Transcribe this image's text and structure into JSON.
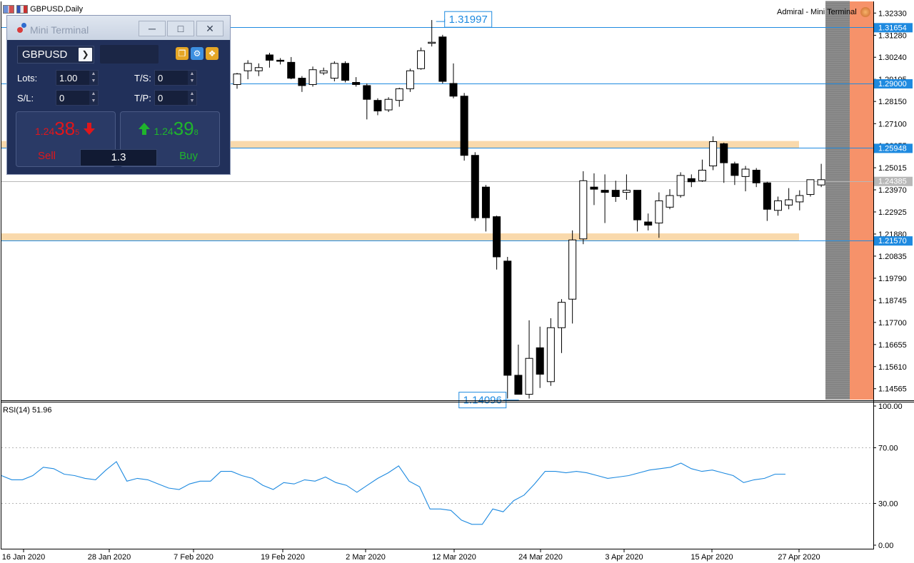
{
  "window": {
    "title": "GBPUSD,Daily",
    "broker_label": "Admiral - Mini Terminal"
  },
  "mini_terminal": {
    "title": "Mini Terminal",
    "symbol": "GBPUSD",
    "lots_label": "Lots:",
    "lots_value": "1.00",
    "ts_label": "T/S:",
    "ts_value": "0",
    "sl_label": "S/L:",
    "sl_value": "0",
    "tp_label": "T/P:",
    "tp_value": "0",
    "sell": {
      "prefix": "1.24",
      "big": "38",
      "tiny": "5",
      "label": "Sell"
    },
    "buy": {
      "prefix": "1.24",
      "big": "39",
      "tiny": "8",
      "label": "Buy"
    },
    "volume": "1.3",
    "colors": {
      "sell": "#e0161b",
      "buy": "#1fb52c"
    }
  },
  "chart_data": {
    "type": "candlestick",
    "symbol": "GBPUSD",
    "timeframe": "Daily",
    "price_axis": {
      "ylim": [
        1.1405,
        1.3288
      ],
      "tick_labels": [
        "1.32330",
        "1.31280",
        "1.30240",
        "1.29195",
        "1.28150",
        "1.27100",
        "1.26055",
        "1.25015",
        "1.23970",
        "1.22925",
        "1.21880",
        "1.20835",
        "1.19790",
        "1.18745",
        "1.17700",
        "1.16655",
        "1.15610",
        "1.14565"
      ]
    },
    "time_axis": {
      "labels": [
        "16 Jan 2020",
        "28 Jan 2020",
        "7 Feb 2020",
        "19 Feb 2020",
        "2 Mar 2020",
        "12 Mar 2020",
        "24 Mar 2020",
        "3 Apr 2020",
        "15 Apr 2020",
        "27 Apr 2020"
      ]
    },
    "candles": [
      {
        "o": 1.2895,
        "h": 1.295,
        "l": 1.2875,
        "c": 1.2945
      },
      {
        "o": 1.296,
        "h": 1.301,
        "l": 1.292,
        "c": 1.2995
      },
      {
        "o": 1.296,
        "h": 1.2995,
        "l": 1.2935,
        "c": 1.2975
      },
      {
        "o": 1.3035,
        "h": 1.3045,
        "l": 1.2975,
        "c": 1.301
      },
      {
        "o": 1.301,
        "h": 1.302,
        "l": 1.299,
        "c": 1.3005
      },
      {
        "o": 1.3,
        "h": 1.3025,
        "l": 1.292,
        "c": 1.2925
      },
      {
        "o": 1.2925,
        "h": 1.2935,
        "l": 1.286,
        "c": 1.289
      },
      {
        "o": 1.2895,
        "h": 1.298,
        "l": 1.2885,
        "c": 1.2965
      },
      {
        "o": 1.295,
        "h": 1.2975,
        "l": 1.294,
        "c": 1.296
      },
      {
        "o": 1.2925,
        "h": 1.3005,
        "l": 1.291,
        "c": 1.2995
      },
      {
        "o": 1.2995,
        "h": 1.3005,
        "l": 1.2905,
        "c": 1.2915
      },
      {
        "o": 1.2905,
        "h": 1.293,
        "l": 1.2885,
        "c": 1.2895
      },
      {
        "o": 1.289,
        "h": 1.29,
        "l": 1.273,
        "c": 1.2825
      },
      {
        "o": 1.282,
        "h": 1.283,
        "l": 1.275,
        "c": 1.277
      },
      {
        "o": 1.2775,
        "h": 1.2835,
        "l": 1.2765,
        "c": 1.2825
      },
      {
        "o": 1.282,
        "h": 1.288,
        "l": 1.279,
        "c": 1.2875
      },
      {
        "o": 1.2875,
        "h": 1.297,
        "l": 1.286,
        "c": 1.296
      },
      {
        "o": 1.297,
        "h": 1.307,
        "l": 1.2965,
        "c": 1.3055
      },
      {
        "o": 1.309,
        "h": 1.32,
        "l": 1.3075,
        "c": 1.3095
      },
      {
        "o": 1.312,
        "h": 1.313,
        "l": 1.29,
        "c": 1.291
      },
      {
        "o": 1.29,
        "h": 1.2995,
        "l": 1.283,
        "c": 1.284
      },
      {
        "o": 1.284,
        "h": 1.2855,
        "l": 1.2535,
        "c": 1.256
      },
      {
        "o": 1.256,
        "h": 1.2575,
        "l": 1.225,
        "c": 1.2265
      },
      {
        "o": 1.241,
        "h": 1.242,
        "l": 1.22,
        "c": 1.2265
      },
      {
        "o": 1.227,
        "h": 1.2275,
        "l": 1.202,
        "c": 1.208
      },
      {
        "o": 1.206,
        "h": 1.208,
        "l": 1.141,
        "c": 1.152
      },
      {
        "o": 1.152,
        "h": 1.1665,
        "l": 1.143,
        "c": 1.143
      },
      {
        "o": 1.143,
        "h": 1.178,
        "l": 1.141,
        "c": 1.16
      },
      {
        "o": 1.165,
        "h": 1.175,
        "l": 1.146,
        "c": 1.1525
      },
      {
        "o": 1.149,
        "h": 1.179,
        "l": 1.147,
        "c": 1.1745
      },
      {
        "o": 1.1745,
        "h": 1.188,
        "l": 1.1625,
        "c": 1.1865
      },
      {
        "o": 1.188,
        "h": 1.2205,
        "l": 1.1765,
        "c": 1.216
      },
      {
        "o": 1.2165,
        "h": 1.2485,
        "l": 1.214,
        "c": 1.244
      },
      {
        "o": 1.241,
        "h": 1.2475,
        "l": 1.2325,
        "c": 1.24
      },
      {
        "o": 1.2395,
        "h": 1.247,
        "l": 1.224,
        "c": 1.2385
      },
      {
        "o": 1.2395,
        "h": 1.244,
        "l": 1.234,
        "c": 1.2365
      },
      {
        "o": 1.2385,
        "h": 1.247,
        "l": 1.235,
        "c": 1.2395
      },
      {
        "o": 1.2395,
        "h": 1.2395,
        "l": 1.22,
        "c": 1.2255
      },
      {
        "o": 1.2245,
        "h": 1.2285,
        "l": 1.2205,
        "c": 1.223
      },
      {
        "o": 1.224,
        "h": 1.2385,
        "l": 1.217,
        "c": 1.2345
      },
      {
        "o": 1.2315,
        "h": 1.24,
        "l": 1.2305,
        "c": 1.237
      },
      {
        "o": 1.237,
        "h": 1.248,
        "l": 1.236,
        "c": 1.2465
      },
      {
        "o": 1.245,
        "h": 1.247,
        "l": 1.241,
        "c": 1.2435
      },
      {
        "o": 1.244,
        "h": 1.254,
        "l": 1.2435,
        "c": 1.249
      },
      {
        "o": 1.251,
        "h": 1.265,
        "l": 1.249,
        "c": 1.2625
      },
      {
        "o": 1.2615,
        "h": 1.262,
        "l": 1.243,
        "c": 1.2525
      },
      {
        "o": 1.252,
        "h": 1.253,
        "l": 1.242,
        "c": 1.2465
      },
      {
        "o": 1.246,
        "h": 1.251,
        "l": 1.239,
        "c": 1.2495
      },
      {
        "o": 1.249,
        "h": 1.25,
        "l": 1.241,
        "c": 1.243
      },
      {
        "o": 1.243,
        "h": 1.2435,
        "l": 1.225,
        "c": 1.2305
      },
      {
        "o": 1.23,
        "h": 1.2365,
        "l": 1.2275,
        "c": 1.2345
      },
      {
        "o": 1.2325,
        "h": 1.2405,
        "l": 1.2305,
        "c": 1.235
      },
      {
        "o": 1.234,
        "h": 1.2395,
        "l": 1.23,
        "c": 1.237
      },
      {
        "o": 1.2375,
        "h": 1.2445,
        "l": 1.2365,
        "c": 1.2445
      },
      {
        "o": 1.242,
        "h": 1.252,
        "l": 1.241,
        "c": 1.2445
      }
    ],
    "horizontal_lines": [
      {
        "label": "1.31654",
        "y": 1.31654
      },
      {
        "label": "1.29000",
        "y": 1.29
      },
      {
        "label": "1.25948",
        "y": 1.25948
      },
      {
        "label": "1.21570",
        "y": 1.2157
      }
    ],
    "current_price": {
      "label": "1.24385",
      "y": 1.24385
    },
    "zones": [
      {
        "from": 1.2595,
        "to": 1.2628
      },
      {
        "from": 1.2158,
        "to": 1.2191
      }
    ],
    "annotations": [
      {
        "label": "1.31997",
        "price": 1.31997,
        "candle": 18
      },
      {
        "label": "1.14096",
        "price": 1.14096,
        "candle": 25
      }
    ],
    "rsi": {
      "label": "RSI(14) 51.96",
      "ylim": [
        0,
        100
      ],
      "levels": [
        30,
        70
      ],
      "tick_labels": [
        "100.00",
        "70.00",
        "30.00",
        "0.00"
      ],
      "values": [
        50,
        47,
        47,
        50,
        56,
        55,
        51,
        50,
        48,
        47,
        54,
        60,
        46,
        48,
        47,
        44,
        41,
        40,
        44,
        46,
        46,
        53,
        53,
        50,
        48,
        43,
        40,
        45,
        44,
        47,
        46,
        49,
        45,
        43,
        38,
        43,
        48,
        52,
        57,
        46,
        42,
        26,
        26,
        25,
        18,
        15,
        15,
        26,
        24,
        32,
        36,
        44,
        53,
        53,
        52,
        53,
        52,
        50,
        48,
        49,
        50,
        52,
        54,
        55,
        56,
        59,
        55,
        53,
        54,
        52,
        50,
        45,
        47,
        48,
        51,
        51
      ]
    },
    "colors": {
      "line": "#1e8ae0",
      "zone": "#f9d9ac",
      "current_line": "#b8b8b8",
      "band_gray": "#8f8f8f",
      "band_orange": "#f6926a"
    }
  }
}
